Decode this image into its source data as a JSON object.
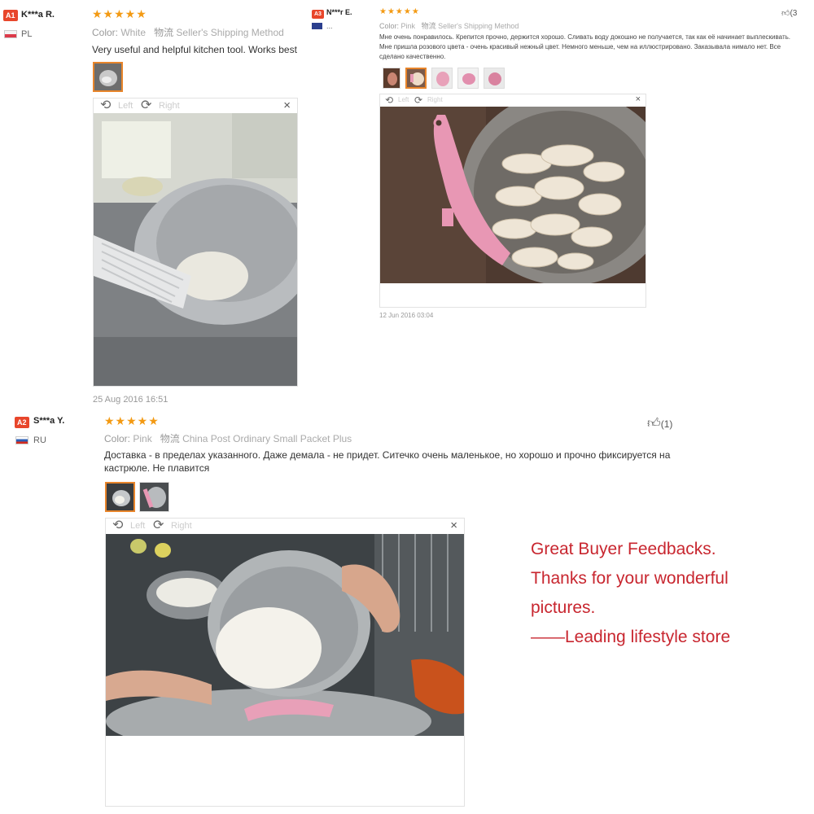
{
  "colors": {
    "badge": "#e8462b",
    "stars": "#f39a13",
    "promo": "#c8262f",
    "thumb_selected": "#e8852b"
  },
  "icons": {
    "thumb_up": "thumbs-up-icon",
    "rotate_left": "rotate-left-icon",
    "rotate_right": "rotate-right-icon",
    "close": "close-icon",
    "flag": "flag-icon"
  },
  "reviews": [
    {
      "badge": "A1",
      "name": "K***a R.",
      "country": "PL",
      "stars": "★★★★★",
      "color_label": "Color:",
      "color_value": "White",
      "shipping_label": "物流",
      "shipping_value": "Seller's Shipping Method",
      "text": "Very useful and helpful kitchen tool. Works best",
      "viewer": {
        "left": "Left",
        "right": "Right",
        "close": "×"
      },
      "date": "25 Aug 2016 16:51"
    },
    {
      "badge": "A3",
      "name": "N***r E.",
      "country": "...",
      "stars": "★★★★★",
      "color_label": "Color:",
      "color_value": "Pink",
      "shipping_label": "物流",
      "shipping_value": "Seller's Shipping Method",
      "text": "Мне очень понравилось. Крепится прочно, держится хорошо. Сливать воду докошно не получается, так как её начинает выплескивать. Мне пришла розового цвета - очень красивый нежный цвет. Немного меньше, чем на иллюстрировано. Заказывала нимало нет. Все сделано качественно.",
      "helpful": "(3",
      "viewer": {
        "left": "Left",
        "right": "Right",
        "close": "×"
      },
      "date": "12 Jun 2016 03:04"
    },
    {
      "badge": "A2",
      "name": "S***a Y.",
      "country": "RU",
      "stars": "★★★★★",
      "color_label": "Color:",
      "color_value": "Pink",
      "shipping_label": "物流",
      "shipping_value": "China Post Ordinary Small Packet Plus",
      "text": "Доставка - в пределах указанного. Даже демала - не придет. Ситечко очень маленькое, но хорошо и прочно фиксируется на кастрюле. Не плавится",
      "helpful": "(1)",
      "viewer": {
        "left": "Left",
        "right": "Right",
        "close": "×"
      }
    }
  ],
  "promo": {
    "line1": "Great Buyer Feedbacks.",
    "line2": "Thanks for your wonderful",
    "line3": "pictures.",
    "line4": "——Leading lifestyle store"
  }
}
